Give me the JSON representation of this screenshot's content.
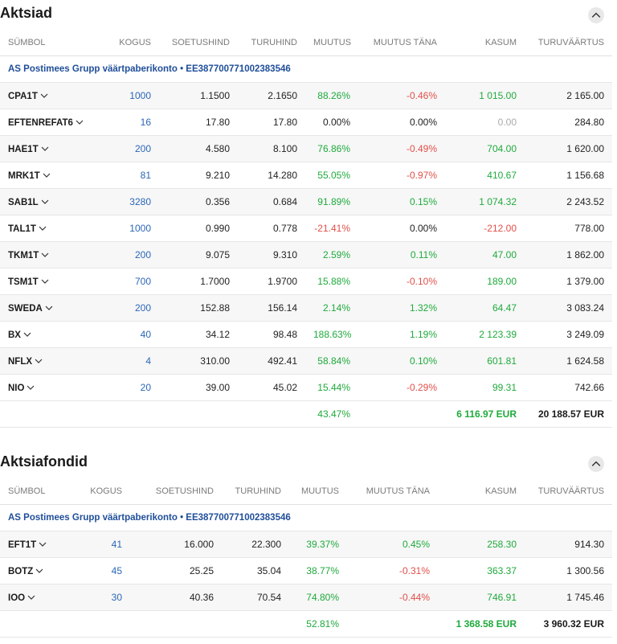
{
  "sections": [
    {
      "title": "Aktsiad",
      "headers": [
        "SÜMBOL",
        "KOGUS",
        "SOETUSHIND",
        "TURUHIND",
        "MUUTUS",
        "MUUTUS TÄNA",
        "KASUM",
        "TURUVÄÄRTUS"
      ],
      "account": "AS Postimees Grupp väärtpaberikonto • EE387700771002383546",
      "rows": [
        {
          "symbol": "CPA1T",
          "qty": "1000",
          "cost": "1.1500",
          "price": "2.1650",
          "change": "88.26%",
          "change_today": "-0.46%",
          "profit": "1 015.00",
          "value": "2 165.00"
        },
        {
          "symbol": "EFTENREFAT6",
          "qty": "16",
          "cost": "17.80",
          "price": "17.80",
          "change": "0.00%",
          "change_today": "0.00%",
          "profit": "0.00",
          "value": "284.80"
        },
        {
          "symbol": "HAE1T",
          "qty": "200",
          "cost": "4.580",
          "price": "8.100",
          "change": "76.86%",
          "change_today": "-0.49%",
          "profit": "704.00",
          "value": "1 620.00"
        },
        {
          "symbol": "MRK1T",
          "qty": "81",
          "cost": "9.210",
          "price": "14.280",
          "change": "55.05%",
          "change_today": "-0.97%",
          "profit": "410.67",
          "value": "1 156.68"
        },
        {
          "symbol": "SAB1L",
          "qty": "3280",
          "cost": "0.356",
          "price": "0.684",
          "change": "91.89%",
          "change_today": "0.15%",
          "profit": "1 074.32",
          "value": "2 243.52"
        },
        {
          "symbol": "TAL1T",
          "qty": "1000",
          "cost": "0.990",
          "price": "0.778",
          "change": "-21.41%",
          "change_today": "0.00%",
          "profit": "-212.00",
          "value": "778.00"
        },
        {
          "symbol": "TKM1T",
          "qty": "200",
          "cost": "9.075",
          "price": "9.310",
          "change": "2.59%",
          "change_today": "0.11%",
          "profit": "47.00",
          "value": "1 862.00"
        },
        {
          "symbol": "TSM1T",
          "qty": "700",
          "cost": "1.7000",
          "price": "1.9700",
          "change": "15.88%",
          "change_today": "-0.10%",
          "profit": "189.00",
          "value": "1 379.00"
        },
        {
          "symbol": "SWEDA",
          "qty": "200",
          "cost": "152.88",
          "price": "156.14",
          "change": "2.14%",
          "change_today": "1.32%",
          "profit": "64.47",
          "value": "3 083.24"
        },
        {
          "symbol": "BX",
          "qty": "40",
          "cost": "34.12",
          "price": "98.48",
          "change": "188.63%",
          "change_today": "1.19%",
          "profit": "2 123.39",
          "value": "3 249.09"
        },
        {
          "symbol": "NFLX",
          "qty": "4",
          "cost": "310.00",
          "price": "492.41",
          "change": "58.84%",
          "change_today": "0.10%",
          "profit": "601.81",
          "value": "1 624.58"
        },
        {
          "symbol": "NIO",
          "qty": "20",
          "cost": "39.00",
          "price": "45.02",
          "change": "15.44%",
          "change_today": "-0.29%",
          "profit": "99.31",
          "value": "742.66"
        }
      ],
      "total": {
        "change": "43.47%",
        "profit": "6 116.97 EUR",
        "value": "20 188.57 EUR"
      }
    },
    {
      "title": "Aktsiafondid",
      "headers": [
        "SÜMBOL",
        "KOGUS",
        "SOETUSHIND",
        "TURUHIND",
        "MUUTUS",
        "MUUTUS TÄNA",
        "KASUM",
        "TURUVÄÄRTUS"
      ],
      "account": "AS Postimees Grupp väärtpaberikonto • EE387700771002383546",
      "rows": [
        {
          "symbol": "EFT1T",
          "qty": "41",
          "cost": "16.000",
          "price": "22.300",
          "change": "39.37%",
          "change_today": "0.45%",
          "profit": "258.30",
          "value": "914.30"
        },
        {
          "symbol": "BOTZ",
          "qty": "45",
          "cost": "25.25",
          "price": "35.04",
          "change": "38.77%",
          "change_today": "-0.31%",
          "profit": "363.37",
          "value": "1 300.56"
        },
        {
          "symbol": "IOO",
          "qty": "30",
          "cost": "40.36",
          "price": "70.54",
          "change": "74.80%",
          "change_today": "-0.44%",
          "profit": "746.91",
          "value": "1 745.46"
        }
      ],
      "total": {
        "change": "52.81%",
        "profit": "1 368.58 EUR",
        "value": "3 960.32 EUR"
      }
    }
  ],
  "colors": {
    "positive": "#1faa3c",
    "negative": "#e0504a",
    "neutral": "#222222",
    "zero_profit": "#aaaaaa",
    "link": "#2a66b8",
    "account": "#1f4e99"
  },
  "icons": {
    "collapse": "chevron-up-icon",
    "expand_row": "chevron-down-icon"
  }
}
